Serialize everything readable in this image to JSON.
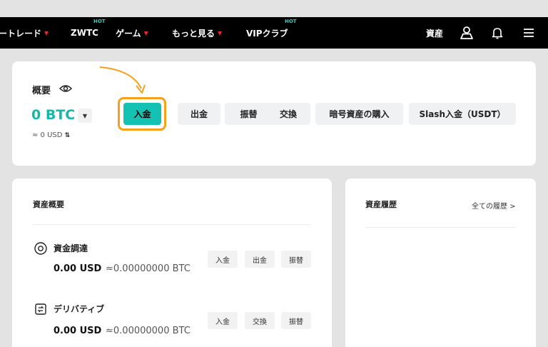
{
  "nav": {
    "items": [
      {
        "label": "ートレード",
        "caret": "▼"
      },
      {
        "label": "ZWTC",
        "badge": "HOT"
      },
      {
        "label": "ゲーム",
        "caret": "▼"
      },
      {
        "label": "もっと見る",
        "caret": "▼"
      },
      {
        "label": "VIPクラブ",
        "badge": "HOT"
      }
    ],
    "assets_label": "資産",
    "icons": [
      "user-icon",
      "bell-icon",
      "menu-icon"
    ]
  },
  "overview": {
    "label": "概要",
    "btc_balance": "0 BTC",
    "dropdown_caret": "▼",
    "usd_balance": "≈ 0 USD",
    "swap_glyph": "⇅",
    "actions": [
      "入金",
      "出金",
      "振替",
      "交換",
      "暗号資産の購入",
      "Slash入金（USDT）"
    ]
  },
  "assets_overview": {
    "title": "資産概要",
    "rows": [
      {
        "title": "資金調達",
        "usd": "0.00 USD",
        "btc": "≈0.00000000 BTC",
        "icon": "funding-icon",
        "actions": [
          "入金",
          "出金",
          "振替"
        ]
      },
      {
        "title": "デリバティブ",
        "usd": "0.00 USD",
        "btc": "≈0.00000000 BTC",
        "icon": "derivatives-icon",
        "actions": [
          "入金",
          "交換",
          "振替"
        ]
      }
    ]
  },
  "history": {
    "title": "資産履歴",
    "all_link": "全ての履歴 >"
  },
  "colors": {
    "accent": "#14c2b4",
    "highlight": "#f5a11a",
    "caret_red": "#e8272c"
  }
}
